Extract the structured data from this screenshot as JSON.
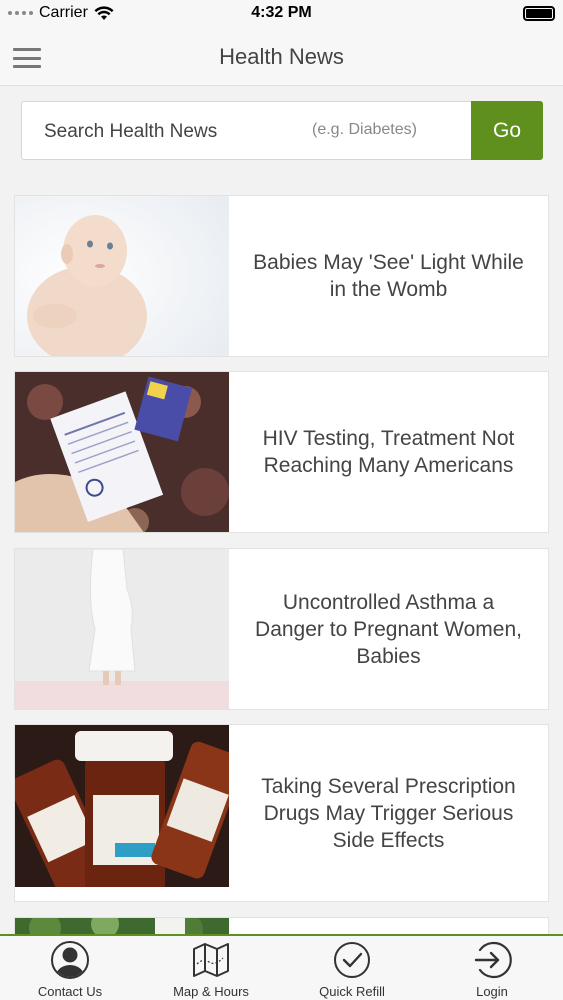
{
  "status_bar": {
    "carrier": "Carrier",
    "time": "4:32 PM"
  },
  "header": {
    "title": "Health News",
    "menu_icon": "hamburger-icon"
  },
  "search": {
    "label": "Search Health News",
    "hint": "(e.g. Diabetes)",
    "button_label": "Go",
    "button_color": "#5f901d"
  },
  "news": [
    {
      "title": "Babies May 'See' Light While in the Womb",
      "image": "baby-photo"
    },
    {
      "title": "HIV Testing, Treatment Not Reaching Many Americans",
      "image": "hiv-test-kit-photo"
    },
    {
      "title": "Uncontrolled Asthma a Danger to Pregnant Women, Babies",
      "image": "pregnant-woman-photo"
    },
    {
      "title": "Taking Several Prescription Drugs May Trigger Serious Side Effects",
      "image": "pill-bottles-photo"
    },
    {
      "title": "",
      "image": "outdoor-photo"
    }
  ],
  "tab_bar": {
    "accent": "#5f901d",
    "tabs": [
      {
        "label": "Contact Us",
        "icon": "person-icon"
      },
      {
        "label": "Map & Hours",
        "icon": "map-icon"
      },
      {
        "label": "Quick Refill",
        "icon": "checkmark-circle-icon"
      },
      {
        "label": "Login",
        "icon": "login-icon"
      }
    ]
  }
}
